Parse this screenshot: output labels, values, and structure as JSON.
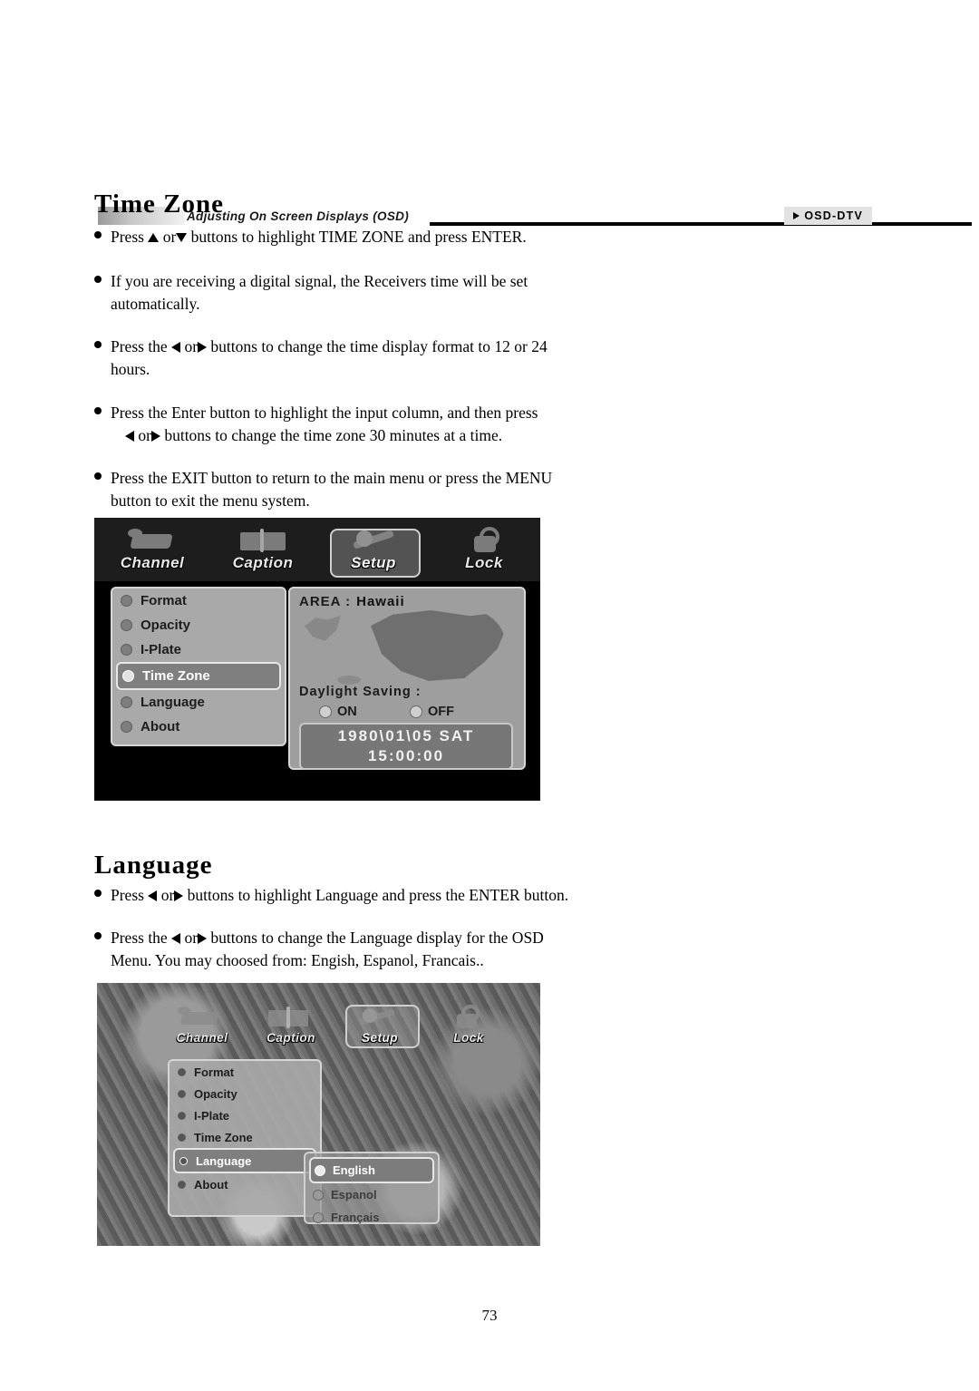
{
  "header": {
    "section_title": "Adjusting On Screen Displays (OSD)",
    "tag": "OSD-DTV"
  },
  "sections": [
    {
      "heading": "Time Zone",
      "bullets": [
        {
          "pre": "Press ",
          "arrow1": "up",
          "mid": " or",
          "arrow2": "down",
          "post": "  buttons to highlight TIME ZONE and press ENTER."
        },
        {
          "line1": "If you are receiving a digital signal, the Receivers time will be set",
          "line2": "automatically."
        },
        {
          "pre": "Press the ",
          "arrow1": "left",
          "mid": " or",
          "arrow2": "right",
          "post": " buttons to change the time display format to 12 or 24",
          "line2": "hours."
        },
        {
          "line1": "Press the Enter button to highlight the input column, and then press",
          "arrow1": "left",
          "mid2": " or",
          "arrow2": "right",
          "post2": " buttons to change the time zone 30 minutes at a time."
        },
        {
          "line1": "Press the EXIT button to return to the main menu or press the MENU",
          "line2": "button to exit the menu system."
        }
      ]
    },
    {
      "heading": "Language",
      "bullets": [
        {
          "pre": "Press ",
          "arrow1": "left",
          "mid": " or",
          "arrow2": "right",
          "post": "  buttons to highlight Language and press the ENTER button."
        },
        {
          "pre": "Press the ",
          "arrow1": "left",
          "mid": " or",
          "arrow2": "right",
          "post": " buttons to change the Language display for the OSD",
          "line2": "Menu. You may choosed from: Engish, Espanol, Francais.."
        }
      ]
    }
  ],
  "osd_timezone": {
    "tabs": [
      {
        "label": "Channel",
        "selected": false
      },
      {
        "label": "Caption",
        "selected": false
      },
      {
        "label": "Setup",
        "selected": true
      },
      {
        "label": "Lock",
        "selected": false
      }
    ],
    "menu": [
      {
        "label": "Format",
        "active": false
      },
      {
        "label": "Opacity",
        "active": false
      },
      {
        "label": "I-Plate",
        "active": false
      },
      {
        "label": "Time  Zone",
        "active": true
      },
      {
        "label": "Language",
        "active": false
      },
      {
        "label": "About",
        "active": false
      }
    ],
    "area_label": "AREA :",
    "area_value": "Hawaii",
    "daylight_label": "Daylight  Saving :",
    "daylight_on": "ON",
    "daylight_off": "OFF",
    "clock_date": "1980\\01\\05    SAT",
    "clock_time": "15:00:00"
  },
  "osd_language": {
    "tabs": [
      {
        "label": "Channel",
        "selected": false
      },
      {
        "label": "Caption",
        "selected": false
      },
      {
        "label": "Setup",
        "selected": true
      },
      {
        "label": "Lock",
        "selected": false
      }
    ],
    "menu": [
      {
        "label": "Format",
        "active": false
      },
      {
        "label": "Opacity",
        "active": false
      },
      {
        "label": "I-Plate",
        "active": false
      },
      {
        "label": "Time  Zone",
        "active": false
      },
      {
        "label": "Language",
        "active": true
      },
      {
        "label": "About",
        "active": false
      }
    ],
    "options": [
      {
        "label": "English",
        "active": true
      },
      {
        "label": "Espanol",
        "active": false
      },
      {
        "label": "Français",
        "active": false
      }
    ]
  },
  "page_number": "73"
}
